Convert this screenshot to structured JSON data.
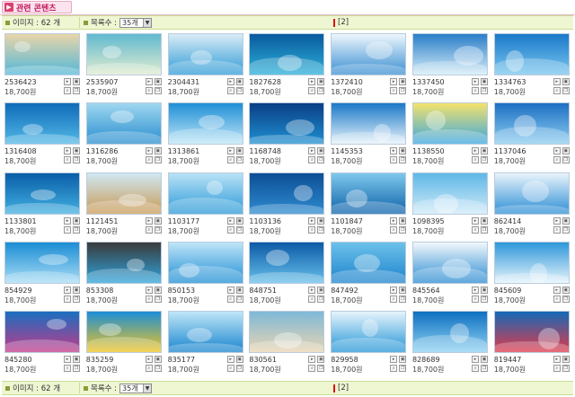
{
  "header": {
    "title": "관련 콘텐츠",
    "colors": {
      "accent": "#d9416f",
      "bar": "#eef6d2"
    }
  },
  "info_top": {
    "count_label": "이미지 : 62 개",
    "list_label": "목록수 :",
    "list_value": "35개",
    "page": "[2]"
  },
  "info_bottom": {
    "count_label": "이미지 : 62 개",
    "list_label": "목록수 :",
    "list_value": "35개",
    "page": "[2]"
  },
  "items": [
    {
      "id": "2536423",
      "price": "18,700원",
      "colors": [
        "#e8d5a8",
        "#54b8d8"
      ]
    },
    {
      "id": "2535907",
      "price": "18,700원",
      "colors": [
        "#62b9d0",
        "#dfeccf"
      ]
    },
    {
      "id": "2304431",
      "price": "18,700원",
      "colors": [
        "#d9ecf6",
        "#2f9bd6"
      ]
    },
    {
      "id": "1827628",
      "price": "18,700원",
      "colors": [
        "#0a5a9e",
        "#2bb0d8"
      ]
    },
    {
      "id": "1372410",
      "price": "18,700원",
      "colors": [
        "#eef6fc",
        "#3a8fd2"
      ]
    },
    {
      "id": "1337450",
      "price": "18,700원",
      "colors": [
        "#2a7ec8",
        "#d4ecf7"
      ]
    },
    {
      "id": "1334763",
      "price": "18,700원",
      "colors": [
        "#1b79c9",
        "#78c6ee"
      ]
    },
    {
      "id": "1316408",
      "price": "18,700원",
      "colors": [
        "#0f6bb8",
        "#52b8e6"
      ]
    },
    {
      "id": "1316286",
      "price": "18,700원",
      "colors": [
        "#9fd7ef",
        "#2a8fd0"
      ]
    },
    {
      "id": "1313861",
      "price": "18,700원",
      "colors": [
        "#1f8fd6",
        "#bfe6f7"
      ]
    },
    {
      "id": "1168748",
      "price": "18,700원",
      "colors": [
        "#0a3f86",
        "#1f8fd0"
      ]
    },
    {
      "id": "1145353",
      "price": "18,700원",
      "colors": [
        "#1a78c8",
        "#e6f2fa"
      ]
    },
    {
      "id": "1138550",
      "price": "18,700원",
      "colors": [
        "#f4e36b",
        "#3aa6e0"
      ]
    },
    {
      "id": "1137046",
      "price": "18,700원",
      "colors": [
        "#1d6fc4",
        "#8ccdf0"
      ]
    },
    {
      "id": "1133801",
      "price": "18,700원",
      "colors": [
        "#0a5ea8",
        "#42b0e0"
      ]
    },
    {
      "id": "1121451",
      "price": "18,700원",
      "colors": [
        "#cfe8f3",
        "#c99a55"
      ]
    },
    {
      "id": "1103177",
      "price": "18,700원",
      "colors": [
        "#b9e2f6",
        "#2b9ad8"
      ]
    },
    {
      "id": "1103136",
      "price": "18,700원",
      "colors": [
        "#0d4f95",
        "#2e8ad0"
      ]
    },
    {
      "id": "1101847",
      "price": "18,700원",
      "colors": [
        "#7ec8ec",
        "#0f63aa"
      ]
    },
    {
      "id": "1098395",
      "price": "18,700원",
      "colors": [
        "#5fb7e6",
        "#cfeaf8"
      ]
    },
    {
      "id": "862414",
      "price": "18,700원",
      "colors": [
        "#eaf4fb",
        "#2e8fd6"
      ]
    },
    {
      "id": "854929",
      "price": "18,700원",
      "colors": [
        "#1b8dd4",
        "#a8dcf5"
      ]
    },
    {
      "id": "853308",
      "price": "18,700원",
      "colors": [
        "#3b3b3b",
        "#2fa3dc"
      ]
    },
    {
      "id": "850153",
      "price": "18,700원",
      "colors": [
        "#bfe5f8",
        "#1f8ed4"
      ]
    },
    {
      "id": "848751",
      "price": "18,700원",
      "colors": [
        "#0c5aa6",
        "#67c0ea"
      ]
    },
    {
      "id": "847492",
      "price": "18,700원",
      "colors": [
        "#6cc1ea",
        "#1e84cc"
      ]
    },
    {
      "id": "845564",
      "price": "18,700원",
      "colors": [
        "#f2f8fc",
        "#2b8cd2"
      ]
    },
    {
      "id": "845609",
      "price": "18,700원",
      "colors": [
        "#2e97da",
        "#e4f3fb"
      ]
    },
    {
      "id": "845280",
      "price": "18,700원",
      "colors": [
        "#1a6fc0",
        "#c23a8a"
      ]
    },
    {
      "id": "835259",
      "price": "18,700원",
      "colors": [
        "#1c8ed8",
        "#f0c420"
      ]
    },
    {
      "id": "835177",
      "price": "18,700원",
      "colors": [
        "#bfe6f8",
        "#1a86cf"
      ]
    },
    {
      "id": "830561",
      "price": "18,700원",
      "colors": [
        "#7fb9d8",
        "#e8d4b2"
      ]
    },
    {
      "id": "829958",
      "price": "18,700원",
      "colors": [
        "#e6f4fb",
        "#2596d8"
      ]
    },
    {
      "id": "828689",
      "price": "18,700원",
      "colors": [
        "#0f70c0",
        "#8fd2f2"
      ]
    },
    {
      "id": "819447",
      "price": "18,700원",
      "colors": [
        "#1469b6",
        "#e03a4a"
      ]
    }
  ]
}
